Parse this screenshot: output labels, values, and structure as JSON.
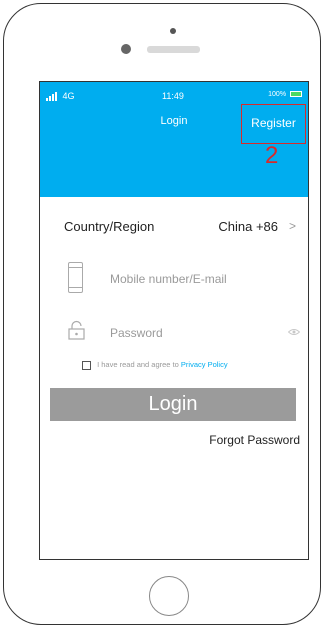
{
  "status_bar": {
    "network": "4G",
    "time": "11:49",
    "battery": "100%"
  },
  "header": {
    "title": "Login",
    "register_label": "Register",
    "annotation_number": "2"
  },
  "form": {
    "country_label": "Country/Region",
    "country_value": "China  +86",
    "chevron": ">",
    "mobile_placeholder": "Mobile number/E-mail",
    "password_placeholder": "Password",
    "agree_text": "I have read and agree to ",
    "privacy_link": "Privacy Policy"
  },
  "actions": {
    "login_label": "Login",
    "forgot_label": "Forgot Password"
  },
  "colors": {
    "header_bg": "#00adef",
    "annotation": "#d82a2a",
    "login_btn_bg": "#9b9b9b",
    "link": "#00adef"
  },
  "icons": [
    "signal-icon",
    "battery-icon",
    "phone-icon",
    "lock-icon",
    "eye-icon",
    "checkbox-icon"
  ]
}
